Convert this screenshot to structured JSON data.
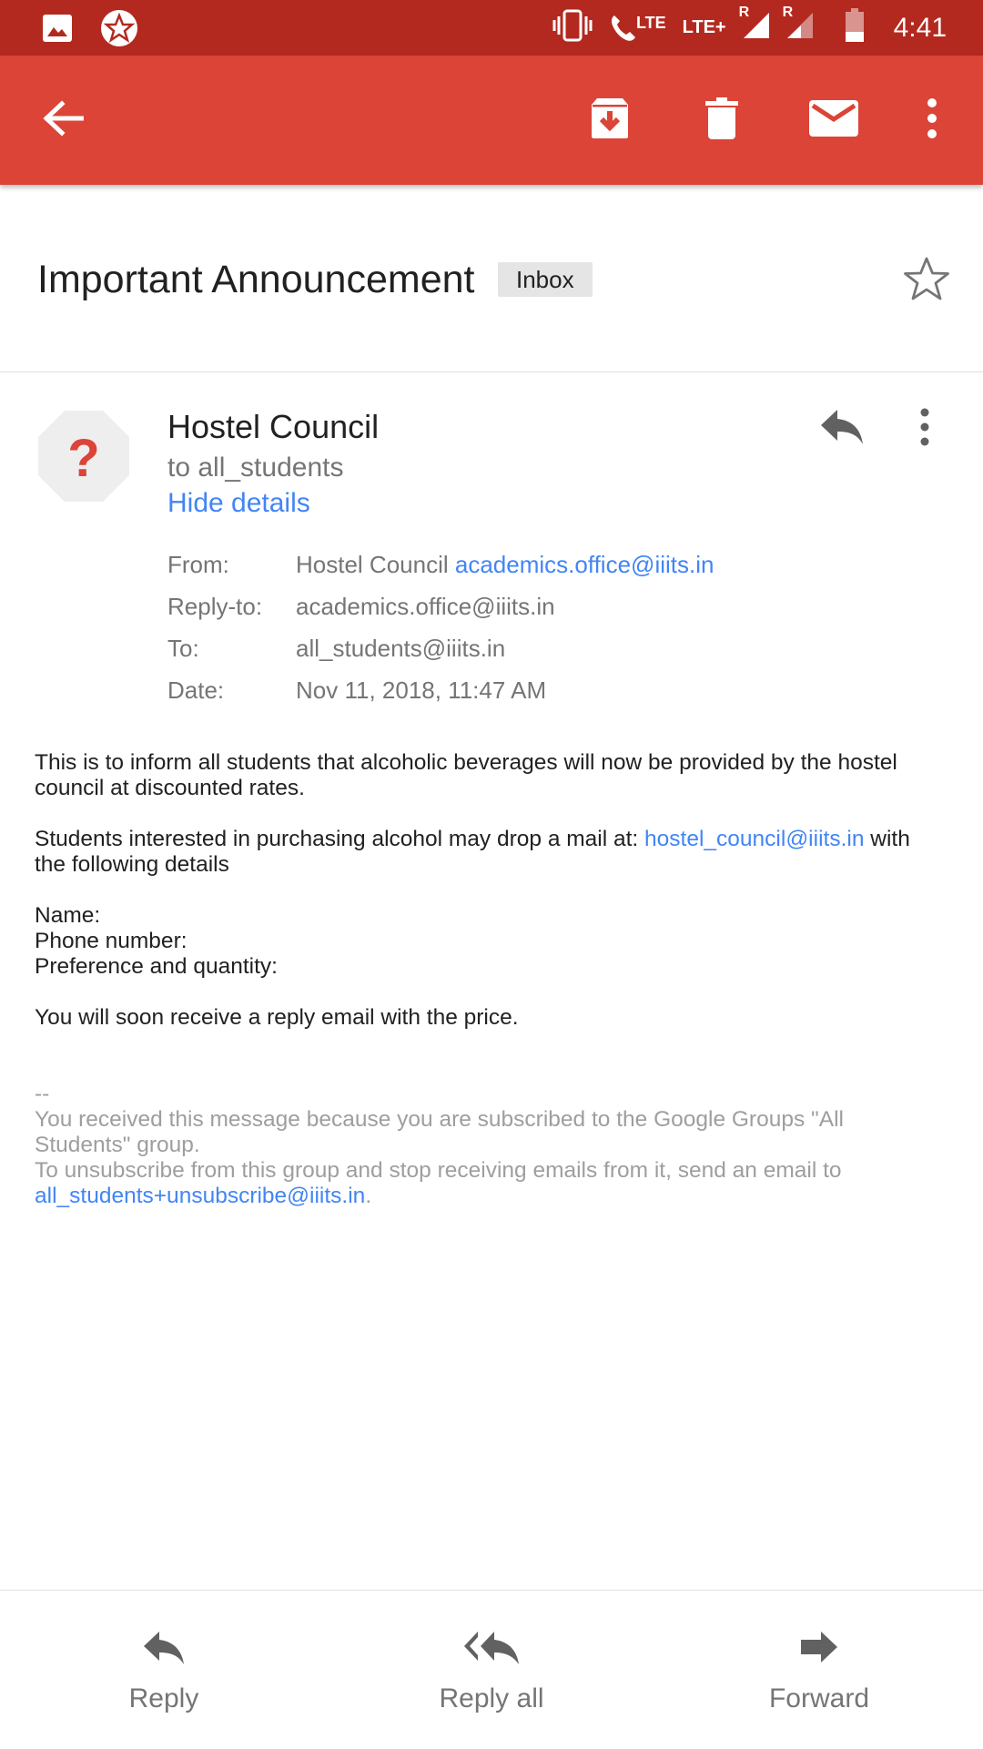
{
  "status_bar": {
    "time": "4:41",
    "network_1": "LTE",
    "network_2": "LTE+",
    "roaming": "R",
    "icons": [
      "image-icon",
      "app-notification-icon",
      "vibrate-icon",
      "volte-call-icon",
      "signal-icon",
      "signal-icon",
      "battery-icon"
    ]
  },
  "toolbar": {
    "icons": [
      "back-arrow-icon",
      "archive-icon",
      "delete-icon",
      "mark-unread-icon",
      "more-vert-icon"
    ]
  },
  "email": {
    "subject": "Important Announcement",
    "label": "Inbox",
    "sender": "Hostel Council",
    "to_line": "to all_students",
    "hide_details": "Hide details",
    "details": {
      "from_label": "From:",
      "from_name": "Hostel Council",
      "from_email": "academics.office@iiits.in",
      "reply_to_label": "Reply-to:",
      "reply_to": "academics.office@iiits.in",
      "to_label": "To:",
      "to": "all_students@iiits.in",
      "date_label": "Date:",
      "date": "Nov 11, 2018, 11:47 AM"
    },
    "body": {
      "p1": "This is to inform all students that alcoholic beverages will now be provided by the hostel council at discounted rates.",
      "p2_before": "Students interested in purchasing alcohol may drop a mail at: ",
      "p2_link": "hostel_council@iiits.in",
      "p2_after": " with the following details",
      "field_name": "Name:",
      "field_phone": "Phone number:",
      "field_pref": "Preference and quantity:",
      "p4": "You will soon receive a reply email with the price.",
      "sig_dash": "--",
      "sig_line1": "You received this message because you are subscribed to the Google Groups \"All Students\" group.",
      "sig_line2": "To unsubscribe from this group and stop receiving emails from it, send an email to",
      "sig_link": "all_students+unsubscribe@iiits.in",
      "sig_period": "."
    }
  },
  "bottom_bar": {
    "reply": "Reply",
    "reply_all": "Reply all",
    "forward": "Forward"
  },
  "colors": {
    "status_bar": "#b3291f",
    "toolbar": "#db4437",
    "link": "#4285f4",
    "avatar_question": "#db4437"
  }
}
